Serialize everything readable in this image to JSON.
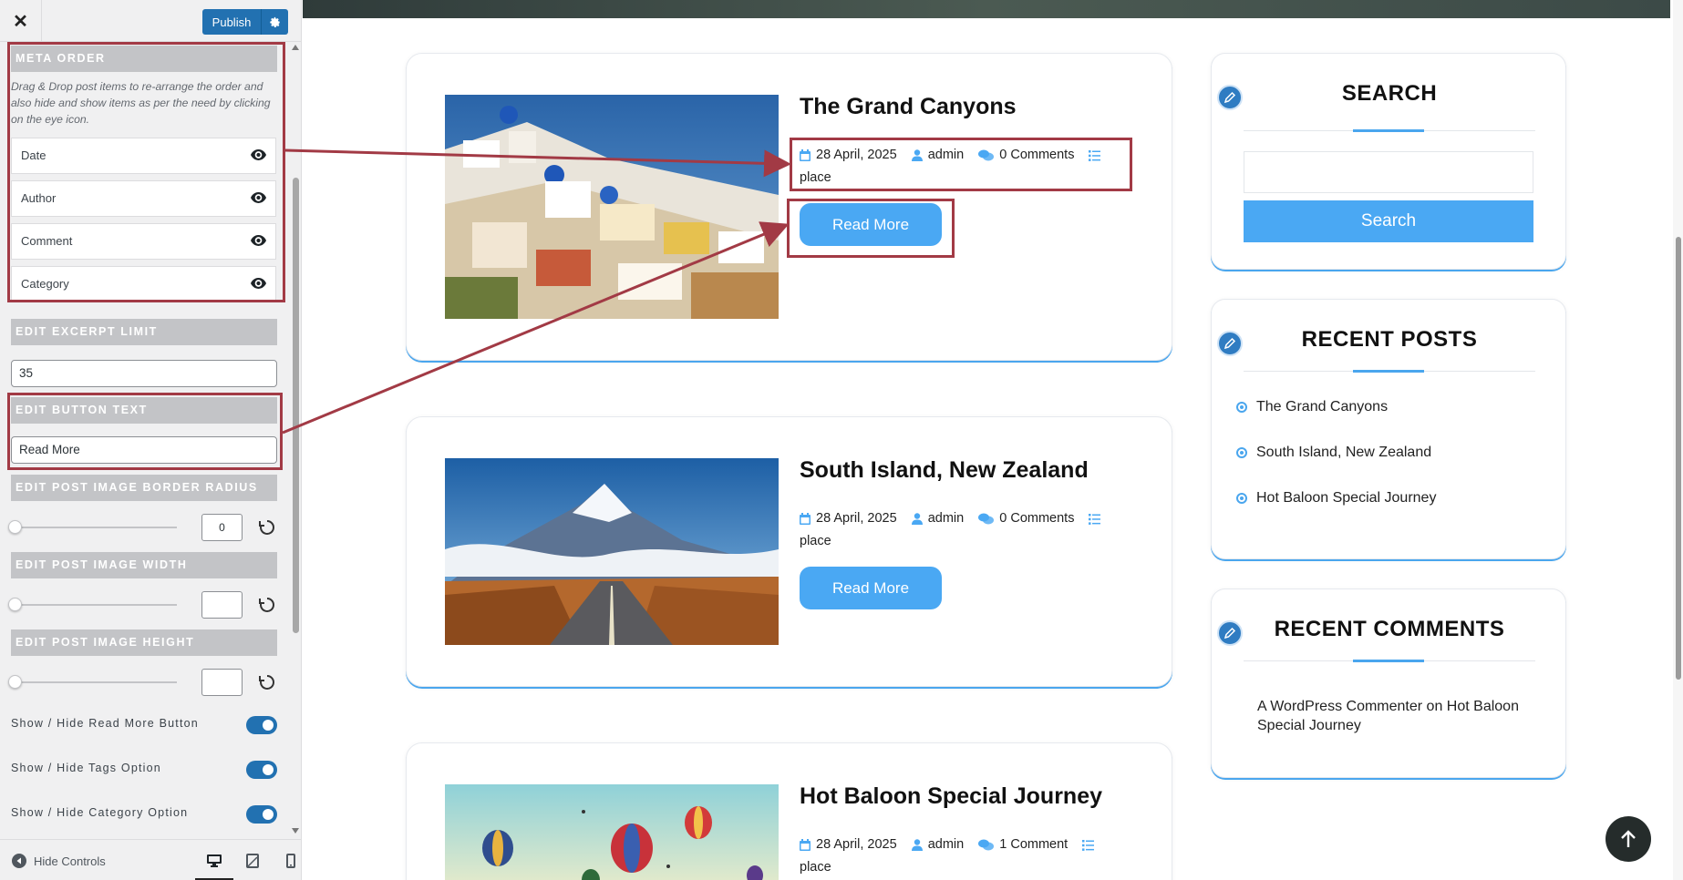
{
  "customizer": {
    "publish_label": "Publish",
    "meta_order": {
      "heading": "META ORDER",
      "description": "Drag & Drop post items to re-arrange the order and also hide and show items as per the need by clicking on the eye icon.",
      "items": [
        "Date",
        "Author",
        "Comment",
        "Category"
      ]
    },
    "excerpt": {
      "heading": "EDIT EXCERPT LIMIT",
      "value": "35"
    },
    "button_text": {
      "heading": "EDIT BUTTON TEXT",
      "value": "Read More"
    },
    "border_radius": {
      "heading": "EDIT POST IMAGE BORDER RADIUS",
      "value": "0"
    },
    "image_width": {
      "heading": "EDIT POST IMAGE WIDTH",
      "value": ""
    },
    "image_height": {
      "heading": "EDIT POST IMAGE HEIGHT",
      "value": ""
    },
    "toggles": [
      {
        "label": "Show / Hide Read More Button",
        "on": true
      },
      {
        "label": "Show / Hide Tags Option",
        "on": true
      },
      {
        "label": "Show / Hide Category Option",
        "on": true
      }
    ],
    "hide_controls": "Hide Controls"
  },
  "posts": [
    {
      "title": "The Grand Canyons",
      "date": "28 April, 2025",
      "author": "admin",
      "comments": "0 Comments",
      "category": "place",
      "button": "Read More"
    },
    {
      "title": "South Island, New Zealand",
      "date": "28 April, 2025",
      "author": "admin",
      "comments": "0 Comments",
      "category": "place",
      "button": "Read More"
    },
    {
      "title": "Hot Baloon Special Journey",
      "date": "28 April, 2025",
      "author": "admin",
      "comments": "1 Comment",
      "category": "place"
    }
  ],
  "sidebar": {
    "search": {
      "title": "SEARCH",
      "button": "Search",
      "placeholder": ""
    },
    "recent_posts": {
      "title": "RECENT POSTS",
      "items": [
        "The Grand Canyons",
        "South Island, New Zealand",
        "Hot Baloon Special Journey"
      ]
    },
    "recent_comments": {
      "title": "RECENT COMMENTS",
      "author": "A WordPress Commenter",
      "connector": "on",
      "post": "Hot Baloon Special Journey"
    }
  },
  "colors": {
    "accent": "#4aa8f3",
    "wp_blue": "#2271b1",
    "annotation": "#a23a45"
  }
}
